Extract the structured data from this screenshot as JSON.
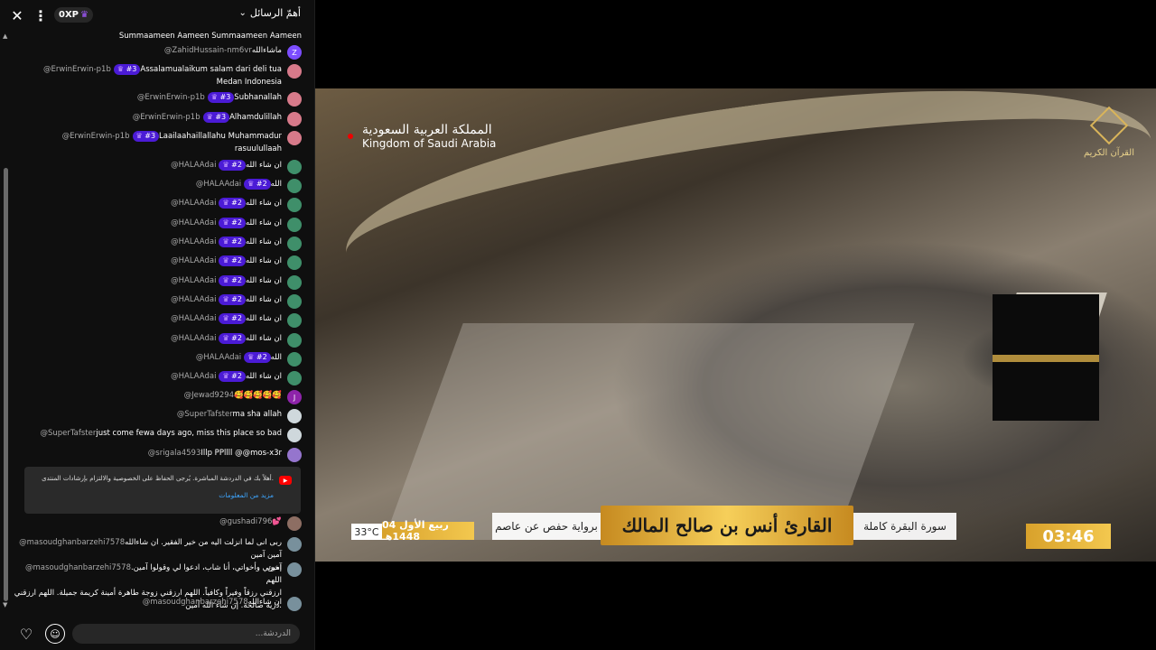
{
  "chat": {
    "mode_label": "أهمّ الرسائل",
    "xp_label": "0XP",
    "input_placeholder": "الدردشة...",
    "messages": [
      {
        "author": "",
        "text": "Summaameen Aameen Summaameen Aameen",
        "badge": "",
        "avatar_color": "",
        "avatar_letter": ""
      },
      {
        "author": "@ZahidHussain-nm6vr",
        "text": "ماشاءالله",
        "badge": "",
        "avatar_color": "#7c4dff",
        "avatar_letter": "Z"
      },
      {
        "author": "@ErwinErwin-p1b",
        "text": "Assalamualaikum salam dari deli tua",
        "line2": "Medan Indonesia",
        "badge": "#3",
        "avatar_color": "#d77a8a",
        "avatar_letter": ""
      },
      {
        "author": "@ErwinErwin-p1b",
        "text": "Subhanallah",
        "badge": "#3",
        "avatar_color": "#d77a8a",
        "avatar_letter": ""
      },
      {
        "author": "@ErwinErwin-p1b",
        "text": "Alhamdulillah",
        "badge": "#3",
        "avatar_color": "#d77a8a",
        "avatar_letter": ""
      },
      {
        "author": "@ErwinErwin-p1b",
        "text": "Laailaahaillallahu Muhammadur",
        "line2": "rasuulullaah",
        "badge": "#3",
        "avatar_color": "#d77a8a",
        "avatar_letter": ""
      },
      {
        "author": "@HALAAdai",
        "text": "ان شاء الله",
        "badge": "#2",
        "avatar_color": "#3f8f6a",
        "avatar_letter": ""
      },
      {
        "author": "@HALAAdai",
        "text": "الله",
        "badge": "#2",
        "avatar_color": "#3f8f6a",
        "avatar_letter": ""
      },
      {
        "author": "@HALAAdai",
        "text": "ان شاء الله",
        "badge": "#2",
        "avatar_color": "#3f8f6a",
        "avatar_letter": ""
      },
      {
        "author": "@HALAAdai",
        "text": "ان شاء الله",
        "badge": "#2",
        "avatar_color": "#3f8f6a",
        "avatar_letter": ""
      },
      {
        "author": "@HALAAdai",
        "text": "ان شاء الله",
        "badge": "#2",
        "avatar_color": "#3f8f6a",
        "avatar_letter": ""
      },
      {
        "author": "@HALAAdai",
        "text": "ان شاء الله",
        "badge": "#2",
        "avatar_color": "#3f8f6a",
        "avatar_letter": ""
      },
      {
        "author": "@HALAAdai",
        "text": "ان شاء الله",
        "badge": "#2",
        "avatar_color": "#3f8f6a",
        "avatar_letter": ""
      },
      {
        "author": "@HALAAdai",
        "text": "ان شاء الله",
        "badge": "#2",
        "avatar_color": "#3f8f6a",
        "avatar_letter": ""
      },
      {
        "author": "@HALAAdai",
        "text": "ان شاء الله",
        "badge": "#2",
        "avatar_color": "#3f8f6a",
        "avatar_letter": ""
      },
      {
        "author": "@HALAAdai",
        "text": "ان شاء الله",
        "badge": "#2",
        "avatar_color": "#3f8f6a",
        "avatar_letter": ""
      },
      {
        "author": "@HALAAdai",
        "text": "الله",
        "badge": "#2",
        "avatar_color": "#3f8f6a",
        "avatar_letter": ""
      },
      {
        "author": "@HALAAdai",
        "text": "ان شاء الله",
        "badge": "#2",
        "avatar_color": "#3f8f6a",
        "avatar_letter": ""
      },
      {
        "author": "@Jewad9294",
        "text": "🥰🥰🥰🥰🥰",
        "badge": "",
        "avatar_color": "#8e24aa",
        "avatar_letter": "J"
      },
      {
        "author": "@SuperTafster",
        "text": "ma sha allah",
        "badge": "",
        "avatar_color": "#cfd8dc",
        "avatar_letter": ""
      },
      {
        "author": "@SuperTafster",
        "text": "just come fewa days ago, miss this place so bad",
        "badge": "",
        "avatar_color": "#cfd8dc",
        "avatar_letter": ""
      },
      {
        "author": "@srigala4593",
        "text": "Illp PPllll @@mos-x3r",
        "badge": "",
        "avatar_color": "#9575cd",
        "avatar_letter": ""
      },
      {
        "author": "@gushadi796",
        "text": "💕",
        "badge": "",
        "avatar_color": "#8d6e63",
        "avatar_letter": ""
      },
      {
        "author": "@masoudghanbarzehi7578",
        "text": "ربی انی لما انزلت الیه من خیر الفقیر. ان شاءالله آمین آمین",
        "line2": "آمین",
        "badge": "",
        "avatar_color": "#78909c",
        "avatar_letter": ""
      },
      {
        "author": "@masoudghanbarzehi7578",
        "text": "إخوتي وأخواتي، أنا شاب، ادعوا لي وقولوا آمين. اللهم",
        "line2": "ارزقني رزقاً وفيراً وكافياً. اللهم ارزقني زوجة طاهرة أمينة كريمة جميلة. اللهم ارزقني ذرية صالحة. إن شاء الله آمين.",
        "badge": "",
        "avatar_color": "#78909c",
        "avatar_letter": ""
      },
      {
        "author": "@masoudghanbarzehi7578",
        "text": "ان شاءالله",
        "badge": "",
        "avatar_color": "#78909c",
        "avatar_letter": ""
      }
    ],
    "notice": {
      "text": "أهلاً بك في الدردشة المباشرة. يُرجى الحفاظ على الخصوصية والالتزام بإرشادات المنتدى.",
      "link": "مزيد من المعلومات"
    }
  },
  "video": {
    "country_ar": "المملكة العربية السعودية",
    "country_en": "Kingdom of Saudi Arabia",
    "channel_name": "القرآن الكريم",
    "temperature": "33°C",
    "hijri_date": "04 ربيع الأول 1448هـ",
    "narration": "برواية حفص عن عاصم",
    "reciter": "القارئ أنس بن صالح المالك",
    "surah": "سورة البقرة كاملة",
    "clock": "03:46"
  }
}
